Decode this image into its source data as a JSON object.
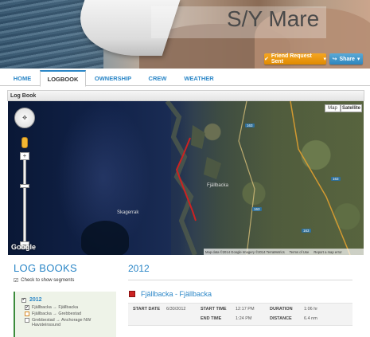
{
  "header": {
    "site_title": "S/Y Mare",
    "friend_button": "Friend Request Sent",
    "share_button": "Share",
    "friend_icon": "check-icon",
    "share_icon": "share-icon"
  },
  "nav": {
    "items": [
      "HOME",
      "LOGBOOK",
      "OWNERSHIP",
      "CREW",
      "WEATHER"
    ],
    "active": "LOGBOOK"
  },
  "panel": {
    "title": "Log Book"
  },
  "map": {
    "type_map": "Map",
    "type_satellite": "Satellite",
    "labels": {
      "sea": "Skagerrak",
      "town": "Fjällbacka"
    },
    "roads": [
      "163",
      "163",
      "163",
      "163"
    ],
    "google": "Google",
    "footer": {
      "data": "Map data ©2014 Google Imagery ©2014 TerraMetrics",
      "terms": "Terms of Use",
      "report": "Report a map error"
    },
    "track_color": "#cc2222"
  },
  "logbooks": {
    "title": "LOG BOOKS",
    "check_note": "Check to show segments",
    "year": "2012",
    "segments": [
      {
        "label": "Fjällbacka → Fjällbacka",
        "checked": true
      },
      {
        "label": "Fjällbacka → Grebbestad",
        "checked": false
      },
      {
        "label": "Grebbestad → Anchorage NW Havsteinssund",
        "checked": false
      }
    ]
  },
  "entry": {
    "year": "2012",
    "title": "Fjällbacka - Fjällbacka",
    "start_date_label": "START DATE",
    "start_date": "6/30/2012",
    "start_time_label": "START TIME",
    "start_time": "12:17 PM",
    "end_time_label": "END TIME",
    "end_time": "1:24 PM",
    "duration_label": "DURATION",
    "duration": "1:06 hr",
    "distance_label": "DISTANCE",
    "distance": "6.4 nm"
  },
  "colors": {
    "accent_blue": "#2a86c7",
    "orange_button": "#f5a623",
    "green_marker": "#3c8c3c"
  }
}
